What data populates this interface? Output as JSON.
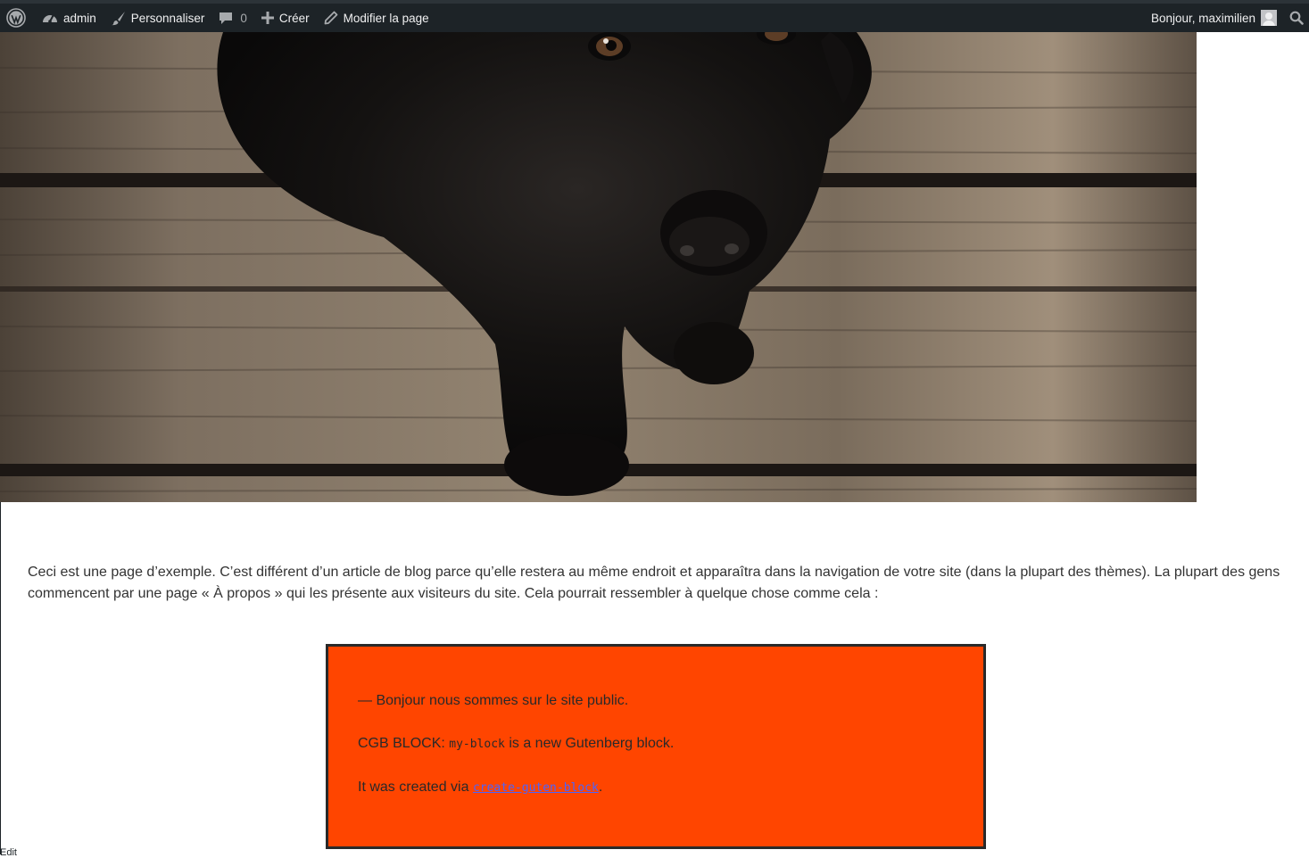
{
  "adminbar": {
    "wp_logo": "wordpress-logo-icon",
    "site_name": "admin",
    "customize": "Personnaliser",
    "comments_count": "0",
    "new": "Créer",
    "edit_page": "Modifier la page",
    "greeting": "Bonjour, maximilien"
  },
  "hero": {
    "subject": "black-labrador-puppy-on-wooden-deck"
  },
  "content": {
    "intro": "Ceci est une page d’exemple. C’est différent d’un article de blog parce qu’elle restera au même endroit et apparaîtra dans la navigation de votre site (dans la plupart des thèmes). La plupart des gens commencent par une page « À propos » qui les présente aux visiteurs du site. Cela pourrait ressembler à quelque chose comme cela :",
    "block": {
      "line1": "— Bonjour nous sommes sur le site public.",
      "line2_prefix": "CGB BLOCK: ",
      "line2_code": "my-block",
      "line2_suffix": " is a new Gutenberg block.",
      "line3_prefix": "It was created via ",
      "line3_link": "create-guten-block",
      "line3_suffix": "."
    },
    "edit_link": "Edit"
  },
  "colors": {
    "adminbar_bg": "#1d2327",
    "block_bg": "#ff4500",
    "block_border": "#292929",
    "link": "#4b63ff",
    "body_text": "#333333"
  }
}
